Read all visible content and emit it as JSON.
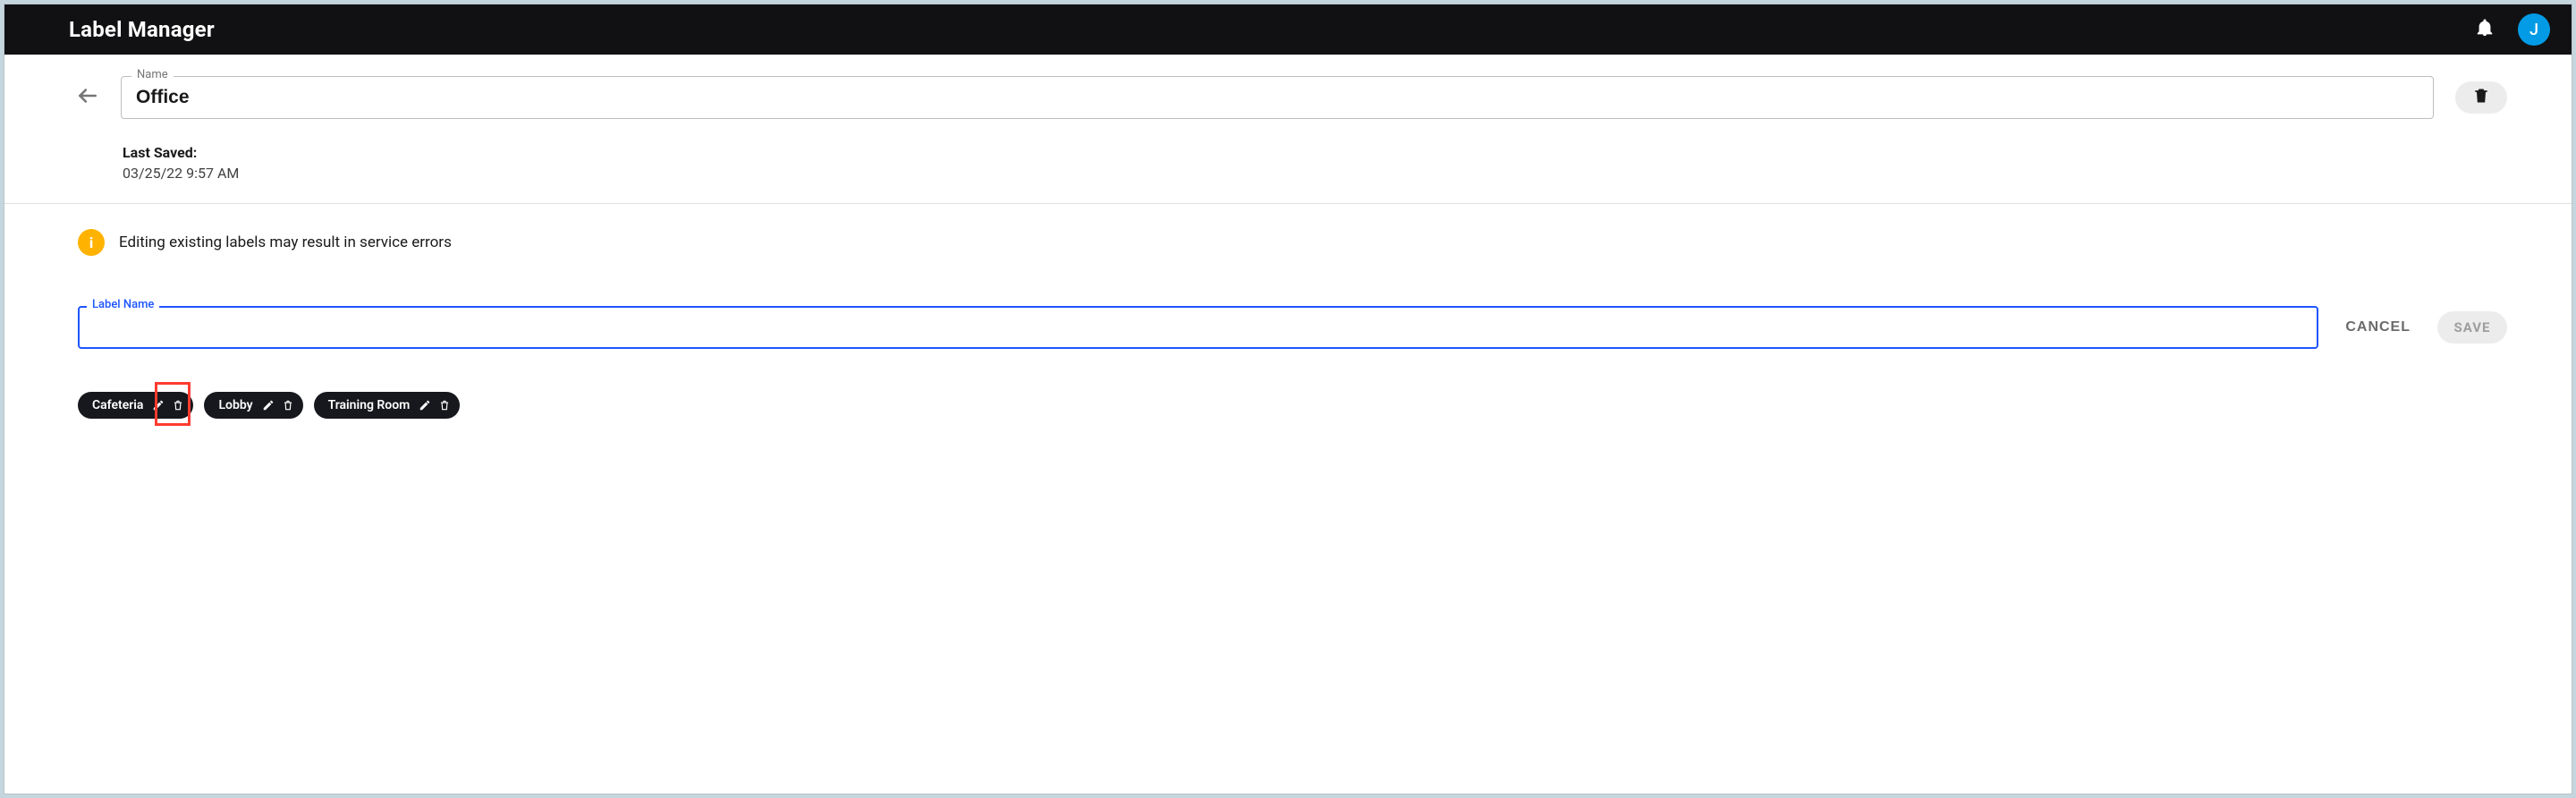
{
  "header": {
    "title": "Label Manager",
    "avatar_initial": "J"
  },
  "name_field": {
    "label": "Name",
    "value": "Office"
  },
  "last_saved": {
    "label": "Last Saved:",
    "timestamp": "03/25/22 9:57 AM"
  },
  "warning": {
    "badge": "i",
    "text": "Editing existing labels may result in service errors"
  },
  "label_input": {
    "label": "Label Name",
    "value": ""
  },
  "actions": {
    "cancel": "CANCEL",
    "save": "SAVE"
  },
  "chips": [
    {
      "name": "Cafeteria"
    },
    {
      "name": "Lobby"
    },
    {
      "name": "Training Room"
    }
  ],
  "colors": {
    "accent": "#1e55ff",
    "warning": "#ffb300",
    "highlight": "#ff3b2f",
    "avatar": "#039be5"
  }
}
